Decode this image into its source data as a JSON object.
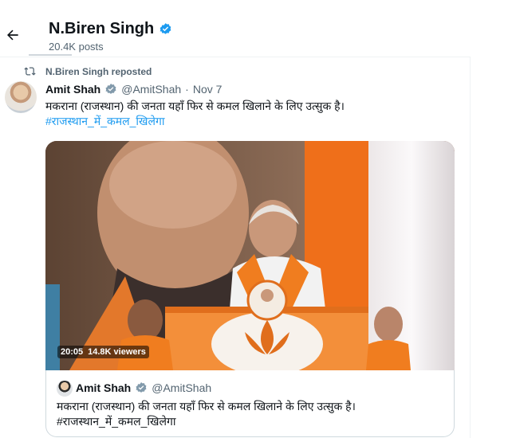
{
  "header": {
    "name": "N.Biren Singh",
    "posts": "20.4K posts"
  },
  "repost": {
    "text": "N.Biren Singh reposted"
  },
  "post": {
    "author_name": "Amit Shah",
    "handle": "@AmitShah",
    "dot": "·",
    "date": "Nov 7",
    "text": "मकराना (राजस्थान) की जनता यहाँ फिर से कमल खिलाने के लिए उत्सुक है।",
    "hashtag": "#राजस्थान_में_कमल_खिलेगा"
  },
  "media": {
    "duration": "20:05",
    "viewers": "14.8K viewers"
  },
  "quote": {
    "author_name": "Amit Shah",
    "handle": "@AmitShah",
    "text": "मकराना (राजस्थान) की जनता यहाँ फिर से कमल खिलाने के लिए उत्सुक है।",
    "hashtag": "#राजस्थान_में_कमल_खिलेगा"
  },
  "colors": {
    "accent": "#1d9bf0",
    "verified": "#1d9bf0",
    "saffron": "#f07d1f"
  }
}
